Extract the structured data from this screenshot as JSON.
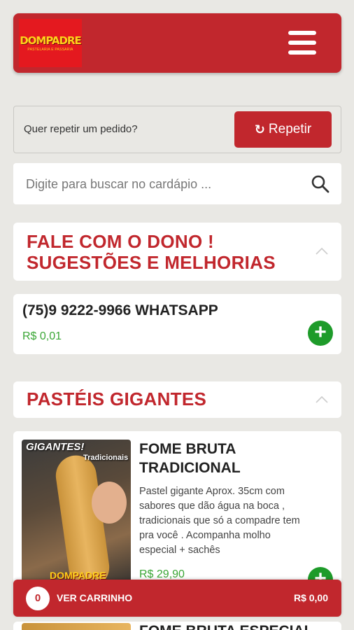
{
  "header": {
    "logo_text": "DOMPADRE",
    "logo_subtext": "PASTELARIA E PASSARIA",
    "menu_icon": "hamburger-menu-icon",
    "colors": {
      "brand_red": "#c1272d",
      "logo_bg": "#e4191f",
      "logo_yellow": "#ffd21a"
    }
  },
  "repeat": {
    "prompt": "Quer repetir um pedido?",
    "button_label": "Repetir",
    "button_icon": "refresh-icon"
  },
  "search": {
    "placeholder": "Digite para buscar no cardápio ...",
    "icon": "search-icon"
  },
  "sections": [
    {
      "title_line1": "FALE COM O DONO !",
      "title_line2": "SUGESTÕES E MELHORIAS",
      "icon": "chevron-up-icon",
      "items": [
        {
          "name": "(75)9 9222-9966 WHATSAPP",
          "price": "R$ 0,01"
        }
      ]
    },
    {
      "title": "PASTÉIS GIGANTES",
      "icon": "chevron-up-icon",
      "items": [
        {
          "name_line1": "FOME BRUTA",
          "name_line2": "TRADICIONAL",
          "description_lines": [
            "Pastel gigante Aprox. 35cm com",
            "sabores que dão água na boca ,",
            "tradicionais que só a compadre tem",
            "pra você . Acompanha molho",
            "especial + sachês"
          ],
          "price": "R$ 29,90",
          "image_text": {
            "headline": "GIGANTES!",
            "subline": "Tradicionais",
            "brand": "DOMPADRE"
          }
        },
        {
          "name": "FOME BRUTA ESPECIAL"
        }
      ]
    }
  ],
  "cart": {
    "count": "0",
    "label": "VER CARRINHO",
    "total": "R$ 0,00"
  },
  "colors": {
    "price_green": "#3aa635",
    "add_button_green": "#1e9b2a",
    "background": "#e9e8e4"
  }
}
